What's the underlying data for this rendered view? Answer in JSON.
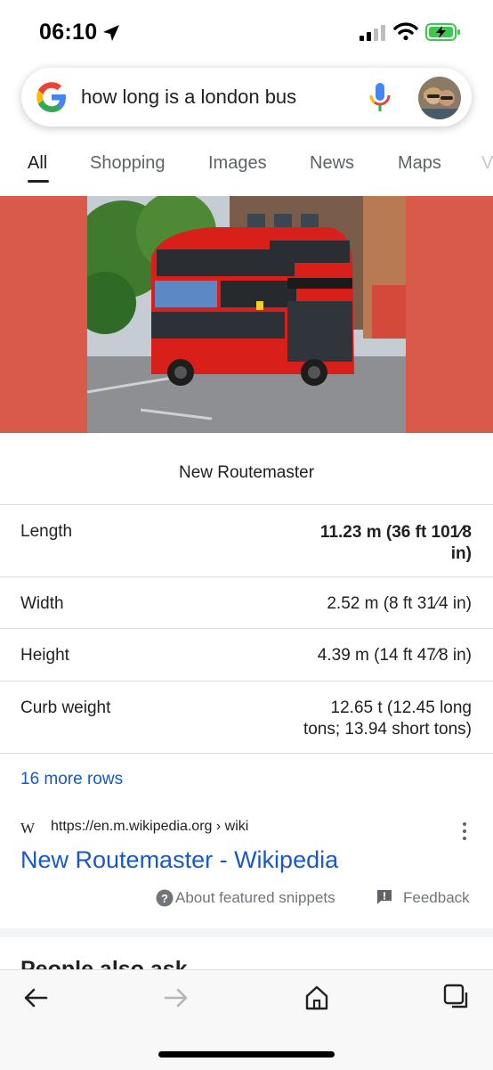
{
  "status_bar": {
    "time": "06:10",
    "icons": [
      "location-arrow-icon",
      "signal-icon",
      "wifi-icon",
      "battery-charging-icon"
    ],
    "battery_color": "#3cc74e"
  },
  "search": {
    "query": "how long is a london bus",
    "icons": [
      "google-logo-icon",
      "microphone-icon",
      "account-avatar"
    ]
  },
  "tabs": [
    {
      "label": "All",
      "active": true
    },
    {
      "label": "Shopping"
    },
    {
      "label": "Images"
    },
    {
      "label": "News"
    },
    {
      "label": "Maps"
    },
    {
      "label": "V"
    }
  ],
  "knowledge": {
    "caption": "New Routemaster",
    "image_bg_color": "#d95a4a",
    "rows": [
      {
        "label": "Length",
        "value_line1": "11.23 m (36 ft 101⁄8",
        "value_line2": "in)",
        "bold": true
      },
      {
        "label": "Width",
        "value_line1": "2.52 m (8 ft 31⁄4 in)"
      },
      {
        "label": "Height",
        "value_line1": "4.39 m (14 ft 47⁄8 in)"
      },
      {
        "label": "Curb weight",
        "value_line1": "12.65 t (12.45 long",
        "value_line2": "tons; 13.94 short tons)"
      }
    ],
    "more_rows": "16 more rows"
  },
  "result": {
    "source_icon": "W",
    "url": "https://en.m.wikipedia.org › wiki",
    "title": "New Routemaster - Wikipedia",
    "about_label": "About featured snippets",
    "feedback_label": "Feedback",
    "link_color": "#1a57c8"
  },
  "people_also_ask": "People also ask",
  "bottom_nav": [
    "back-arrow-icon",
    "forward-arrow-icon",
    "home-icon",
    "tabs-icon"
  ]
}
